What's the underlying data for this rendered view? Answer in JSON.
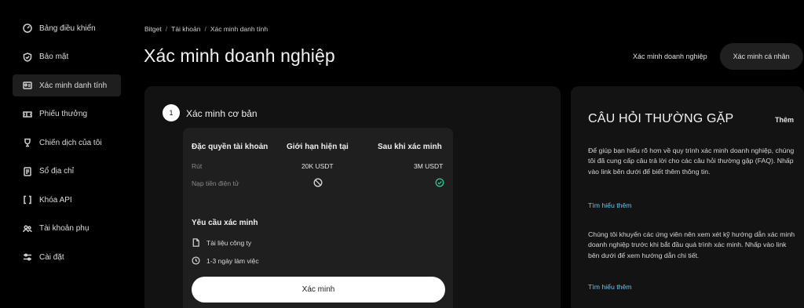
{
  "sidebar": {
    "items": [
      {
        "label": "Bảng điều khiển",
        "icon": "dashboard-icon"
      },
      {
        "label": "Bảo mật",
        "icon": "shield-icon"
      },
      {
        "label": "Xác minh danh tính",
        "icon": "id-card-icon"
      },
      {
        "label": "Phiếu thưởng",
        "icon": "coupon-icon"
      },
      {
        "label": "Chiến dịch của tôi",
        "icon": "trophy-icon"
      },
      {
        "label": "Sổ địa chỉ",
        "icon": "address-book-icon"
      },
      {
        "label": "Khóa API",
        "icon": "api-key-icon"
      },
      {
        "label": "Tài khoản phụ",
        "icon": "sub-account-icon"
      },
      {
        "label": "Cài đặt",
        "icon": "settings-icon"
      }
    ],
    "active_index": 2
  },
  "breadcrumb": {
    "items": [
      "Bitget",
      "Tài khoản",
      "Xác minh danh tính"
    ],
    "separator": "/"
  },
  "page": {
    "title": "Xác minh doanh nghiệp"
  },
  "type_tabs": {
    "business": "Xác minh doanh nghiệp",
    "personal": "Xác minh cá nhân",
    "active": "personal"
  },
  "step": {
    "number": "1",
    "title": "Xác minh cơ bản"
  },
  "privileges_table": {
    "headers": [
      "Đặc quyền tài khoản",
      "Giới hạn hiện tại",
      "Sau khi xác minh"
    ],
    "rows": [
      {
        "label": "Rút",
        "current": "20K USDT",
        "after": "3M USDT"
      },
      {
        "label": "Nạp tiền điện tử",
        "current_icon": "ban-icon",
        "after_icon": "check-circle-icon"
      }
    ]
  },
  "requirements": {
    "title": "Yêu cầu xác minh",
    "items": [
      {
        "icon": "document-icon",
        "label": "Tài liệu công ty"
      },
      {
        "icon": "clock-icon",
        "label": "1-3 ngày làm việc"
      }
    ]
  },
  "verify_button": "Xác minh",
  "faq": {
    "title": "CÂU HỎI THƯỜNG GẶP",
    "more": "Thêm",
    "paragraphs": [
      "Để giúp bạn hiểu rõ hơn về quy trình xác minh doanh nghiệp, chúng tôi đã cung cấp câu trả lời cho các câu hỏi thường gặp (FAQ). Nhấp vào link bên dưới để biết thêm thông tin.",
      "Chúng tôi khuyến các ứng viên nên xem xét kỹ hướng dẫn xác minh doanh nghiệp trước khi bắt đầu quá trình xác minh. Nhấp vào link bên dưới để xem hướng dẫn chi tiết."
    ],
    "link_label": "Tìm hiểu thêm"
  },
  "colors": {
    "background": "#000000",
    "card": "#121212",
    "inner_card": "#1f1f1f",
    "link": "#6fc3e8",
    "success": "#2fc48d"
  }
}
